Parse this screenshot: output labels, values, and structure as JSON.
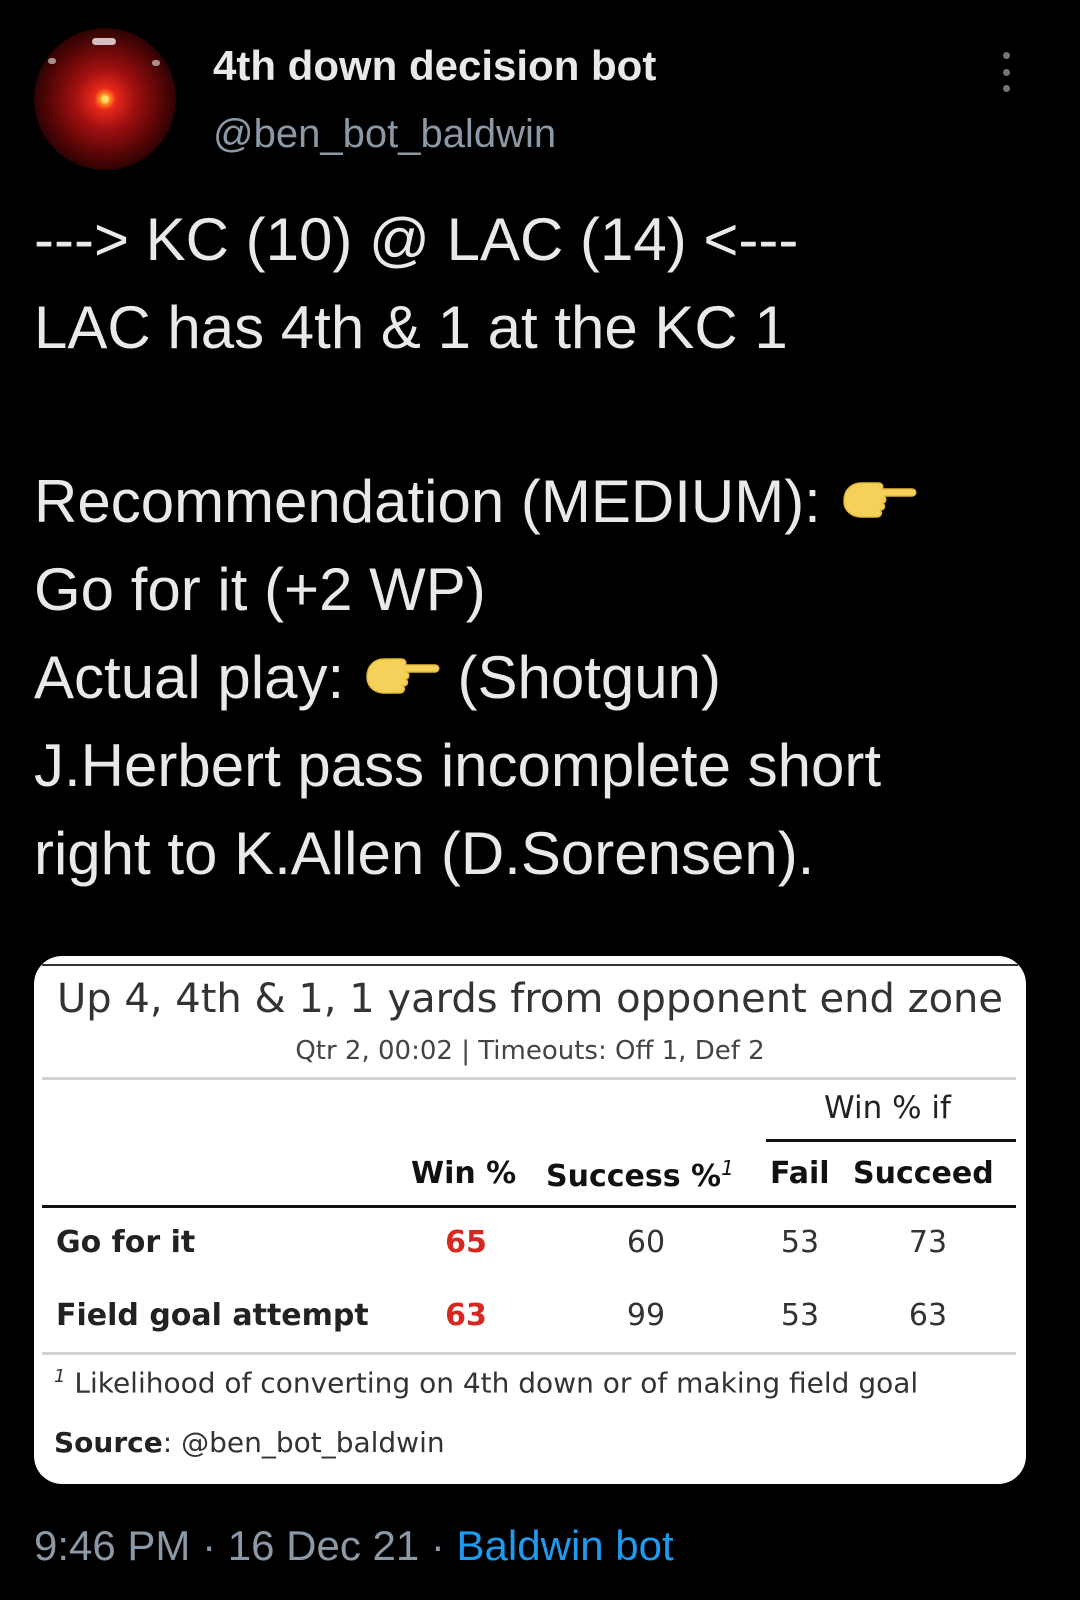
{
  "author": {
    "display_name": "4th down decision bot",
    "handle": "@ben_bot_baldwin",
    "avatar_icon": "hal-9000-eye-icon"
  },
  "tweet": {
    "line1": "---> KC (10) @ LAC (14) <---",
    "line2": "LAC has 4th & 1 at the KC 1",
    "line3": "Recommendation (MEDIUM):",
    "line4": "Go for it (+2 WP)",
    "line5_prefix": "Actual play:",
    "line5_suffix": "(Shotgun)",
    "line6": "J.Herbert pass incomplete short",
    "line7": "right to K.Allen (D.Sorensen).",
    "emoji_icon": "pointing-hand-right-icon"
  },
  "card": {
    "title": "Up 4, 4th & 1, 1 yards from opponent end zone",
    "subtitle": "Qtr 2, 00:02 | Timeouts: Off 1, Def 2",
    "spanner": "Win % if",
    "columns": {
      "win": "Win %",
      "success": "Success %",
      "success_note": "1",
      "fail": "Fail",
      "succeed": "Succeed"
    },
    "rows": [
      {
        "label": "Go for it",
        "win": "65",
        "success": "60",
        "fail": "53",
        "succeed": "73"
      },
      {
        "label": "Field goal attempt",
        "win": "63",
        "success": "99",
        "fail": "53",
        "succeed": "63"
      }
    ],
    "footnote_mark": "1",
    "footnote": "Likelihood of converting on 4th down or of making field goal",
    "source_label": "Source",
    "source_value": ": @ben_bot_baldwin",
    "accent_color": "#d62820"
  },
  "meta": {
    "time": "9:46 PM",
    "sep1": " · ",
    "date": "16 Dec 21",
    "sep2": " · ",
    "app": "Baldwin bot"
  },
  "colors": {
    "background": "#000000",
    "text": "#e7e9ea",
    "muted": "#8b98a5",
    "link": "#1d9bf0"
  }
}
